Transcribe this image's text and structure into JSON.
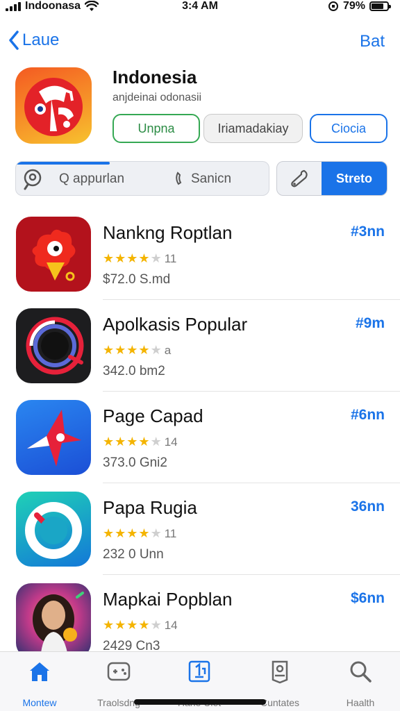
{
  "status_bar": {
    "carrier": "Indoonasa",
    "time": "3:4 AM",
    "battery": "79%",
    "battery_level": 0.79
  },
  "nav": {
    "back_label": "Laue",
    "right_label": "Bat"
  },
  "header": {
    "title": "Indonesia",
    "subtitle": "anjdeinai odonasii",
    "btn_update": "Unpna",
    "btn_middle": "Iriamadakiay",
    "btn_close": "Ciocia"
  },
  "search": {
    "placeholder": "Q appurlan",
    "secondary": "Sanicn",
    "progress": 0.37,
    "segment_button": "Streto"
  },
  "apps": [
    {
      "name": "Nankng Roptlan",
      "rating": 4,
      "rating_count": "11",
      "size": "$72.0 S.md",
      "price": "#3nn",
      "icon": "red-bird-icon",
      "color": "#b3121c"
    },
    {
      "name": "Apolkasis Popular",
      "rating": 4,
      "rating_count": "a",
      "size": "342.0 bm2",
      "price": "#9m",
      "icon": "ring-icon",
      "color": "#1d1d1f"
    },
    {
      "name": "Page Capad",
      "rating": 4,
      "rating_count": "14",
      "size": "373.0 Gni2",
      "price": "#6nn",
      "icon": "star-plane-icon",
      "color": "#1e63e6"
    },
    {
      "name": "Papa Rugia",
      "rating": 4,
      "rating_count": "11",
      "size": "232 0 Unn",
      "price": "36nn",
      "icon": "lifebuoy-icon",
      "color": "#19a7c9"
    },
    {
      "name": "Mapkai Popblan",
      "rating": 4,
      "rating_count": "14",
      "size": "2429 Cn3",
      "price": "$6nn",
      "icon": "portrait-icon",
      "color": "#2f3b7a"
    }
  ],
  "tabs": [
    {
      "label": "Montew",
      "icon": "home-icon",
      "active": true
    },
    {
      "label": "Traolsdng",
      "icon": "game-controller-icon",
      "active": false
    },
    {
      "label": "Hane Uiet",
      "icon": "apps-icon",
      "active": false
    },
    {
      "label": "Cuntates",
      "icon": "arcade-icon",
      "active": false
    },
    {
      "label": "Haalth",
      "icon": "search-icon",
      "active": false
    }
  ],
  "colors": {
    "accent": "#1a73e8",
    "update_green": "#35a853",
    "star": "#f4b400"
  }
}
